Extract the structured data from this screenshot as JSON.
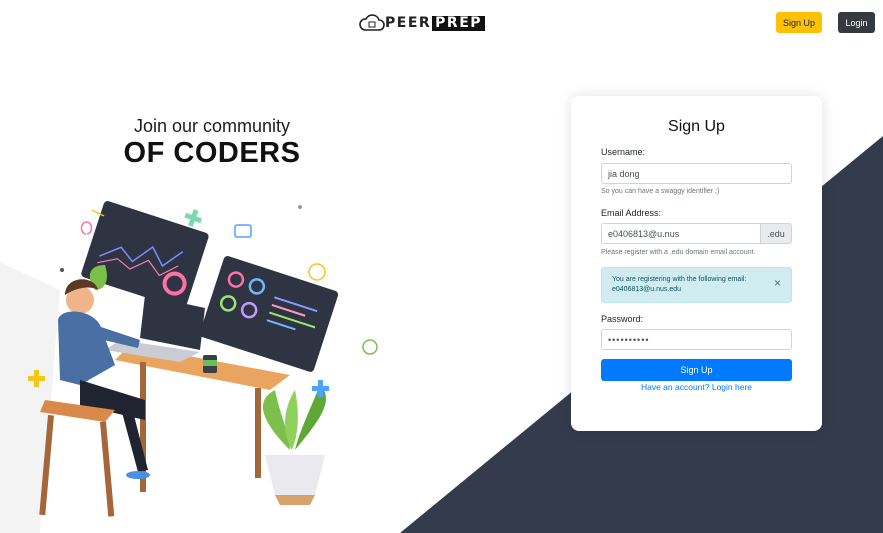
{
  "navbar": {
    "brand_left": "PEER",
    "brand_right": "PREP",
    "signup_label": "Sign Up",
    "login_label": "Login"
  },
  "hero": {
    "line1": "Join our community",
    "line2": "OF CODERS"
  },
  "form": {
    "title": "Sign Up",
    "username_label": "Username:",
    "username_value": "jia dong",
    "username_help": "So you can have a swaggy identifier ;)",
    "email_label": "Email Address:",
    "email_value": "e0406813@u.nus",
    "email_suffix": ".edu",
    "email_help": "Please register with a .edu domain email account.",
    "alert_line1": "You are registering with the following email:",
    "alert_line2": "e0406813@u.nus.edu",
    "alert_close": "×",
    "password_label": "Password:",
    "password_value": "••••••••••",
    "submit_label": "Sign Up",
    "login_link": "Have an account? Login here"
  },
  "colors": {
    "accent_yellow": "#ffc107",
    "dark": "#343a40",
    "primary": "#007bff",
    "info_bg": "#d1ecf1",
    "bg_shape": "#343b4d"
  }
}
